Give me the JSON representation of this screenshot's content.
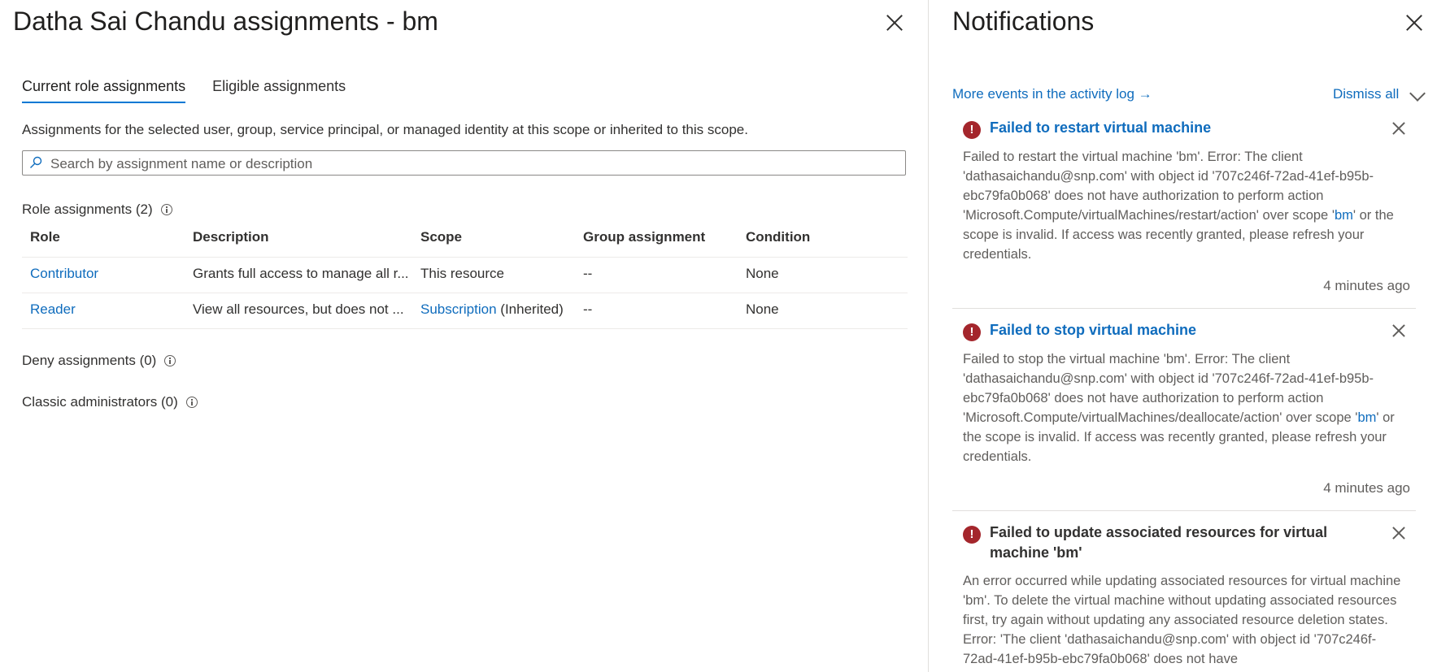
{
  "left": {
    "title": "Datha Sai Chandu assignments - bm",
    "tabs": [
      {
        "label": "Current role assignments",
        "active": true
      },
      {
        "label": "Eligible assignments",
        "active": false
      }
    ],
    "description": "Assignments for the selected user, group, service principal, or managed identity at this scope or inherited to this scope.",
    "search": {
      "placeholder": "Search by assignment name or description",
      "value": ""
    },
    "role_assignments_label": "Role assignments (2)",
    "columns": [
      "Role",
      "Description",
      "Scope",
      "Group assignment",
      "Condition"
    ],
    "rows": [
      {
        "role": "Contributor",
        "description": "Grants full access to manage all r...",
        "scope": "This resource",
        "scope_suffix": "",
        "group": "--",
        "condition": "None"
      },
      {
        "role": "Reader",
        "description": "View all resources, but does not ...",
        "scope": "Subscription",
        "scope_suffix": " (Inherited)",
        "group": "--",
        "condition": "None"
      }
    ],
    "deny_label": "Deny assignments (0)",
    "classic_label": "Classic administrators (0)"
  },
  "notifications": {
    "title": "Notifications",
    "activity_link": "More events in the activity log →",
    "dismiss_all": "Dismiss all",
    "items": [
      {
        "title": "Failed to restart virtual machine",
        "body_pre": "Failed to restart the virtual machine 'bm'. Error: The client 'dathasaichandu@snp.com' with object id '707c246f-72ad-41ef-b95b-ebc79fa0b068' does not have authorization to perform action 'Microsoft.Compute/virtualMachines/restart/action' over scope '",
        "body_link": "bm",
        "body_post": "' or the scope is invalid. If access was recently granted, please refresh your credentials.",
        "time": "4 minutes ago"
      },
      {
        "title": "Failed to stop virtual machine",
        "body_pre": "Failed to stop the virtual machine 'bm'. Error: The client 'dathasaichandu@snp.com' with object id '707c246f-72ad-41ef-b95b-ebc79fa0b068' does not have authorization to perform action 'Microsoft.Compute/virtualMachines/deallocate/action' over scope '",
        "body_link": "bm",
        "body_post": "' or the scope is invalid. If access was recently granted, please refresh your credentials.",
        "time": "4 minutes ago"
      },
      {
        "title": "Failed to update associated resources for virtual machine 'bm'",
        "body": "An error occurred while updating associated resources for virtual machine 'bm'. To delete the virtual machine without updating associated resources first, try again without updating any associated resource deletion states. Error: 'The client 'dathasaichandu@snp.com' with object id '707c246f-72ad-41ef-b95b-ebc79fa0b068' does not have"
      }
    ]
  },
  "colors": {
    "link": "#0f6cbd",
    "error": "#a4262c",
    "tab_underline": "#0078d4"
  }
}
